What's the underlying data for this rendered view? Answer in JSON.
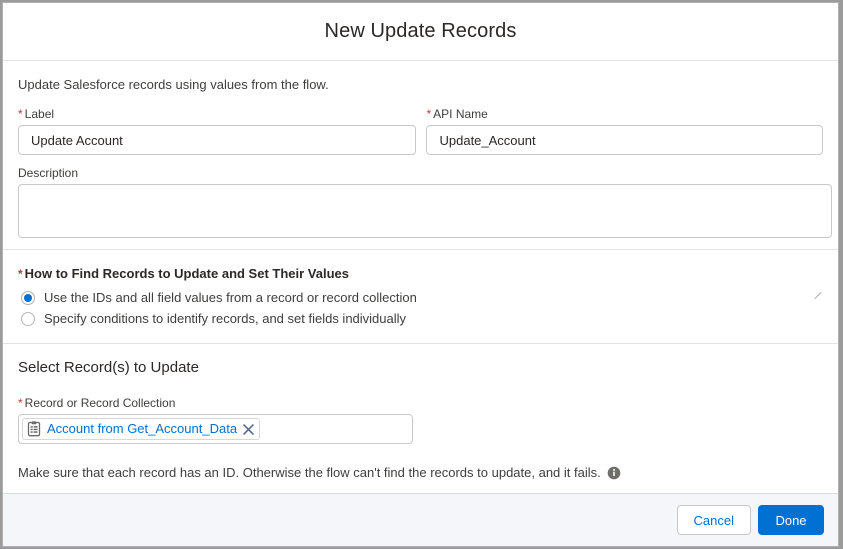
{
  "modal": {
    "title": "New Update Records",
    "intro": "Update Salesforce records using values from the flow."
  },
  "form": {
    "label_field": {
      "label": "Label",
      "required_marker": "*",
      "value": "Update Account",
      "placeholder": ""
    },
    "api_name_field": {
      "label": "API Name",
      "required_marker": "*",
      "value": "Update_Account",
      "placeholder": ""
    },
    "description_field": {
      "label": "Description",
      "value": "",
      "placeholder": ""
    }
  },
  "find_records": {
    "required_marker": "*",
    "legend": "How to Find Records to Update and Set Their Values",
    "options": [
      {
        "label": "Use the IDs and all field values from a record or record collection",
        "selected": true
      },
      {
        "label": "Specify conditions to identify records, and set fields individually",
        "selected": false
      }
    ]
  },
  "select_records": {
    "heading": "Select Record(s) to Update",
    "field_label": "Record or Record Collection",
    "required_marker": "*",
    "pill": {
      "text": "Account from Get_Account_Data",
      "icon": "record-collection-icon",
      "remove_icon": "close-icon"
    },
    "help_text": "Make sure that each record has an ID. Otherwise the flow can't find the records to update, and it fails.",
    "help_icon": "info-icon"
  },
  "footer": {
    "cancel_label": "Cancel",
    "done_label": "Done"
  },
  "colors": {
    "brand_blue": "#0070d2",
    "required_red": "#c23934",
    "text_primary": "#2b2826",
    "text_secondary": "#3e3e3c",
    "border": "#c9c9c9",
    "footer_bg": "#f4f6f9"
  }
}
